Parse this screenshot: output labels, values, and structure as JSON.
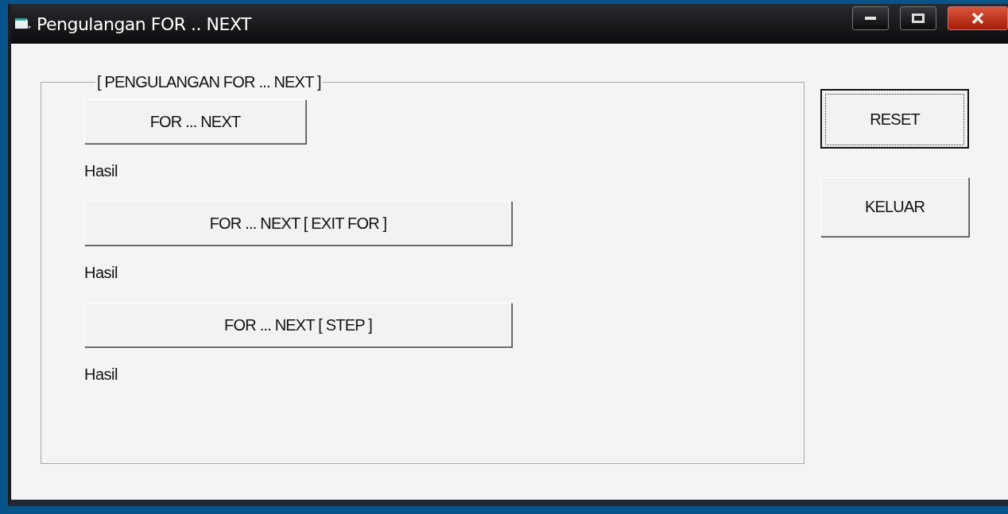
{
  "window": {
    "title": "Pengulangan FOR .. NEXT"
  },
  "group": {
    "title": "[ PENGULANGAN FOR ... NEXT ]",
    "items": [
      {
        "button": "FOR ... NEXT",
        "kind": "short",
        "result": "Hasil"
      },
      {
        "button": "FOR ... NEXT [ EXIT FOR ]",
        "kind": "wide",
        "result": "Hasil"
      },
      {
        "button": "FOR ... NEXT [ STEP  ]",
        "kind": "wide",
        "result": "Hasil"
      }
    ]
  },
  "side_buttons": [
    {
      "label": "RESET",
      "focused": true
    },
    {
      "label": "KELUAR",
      "focused": false
    }
  ]
}
